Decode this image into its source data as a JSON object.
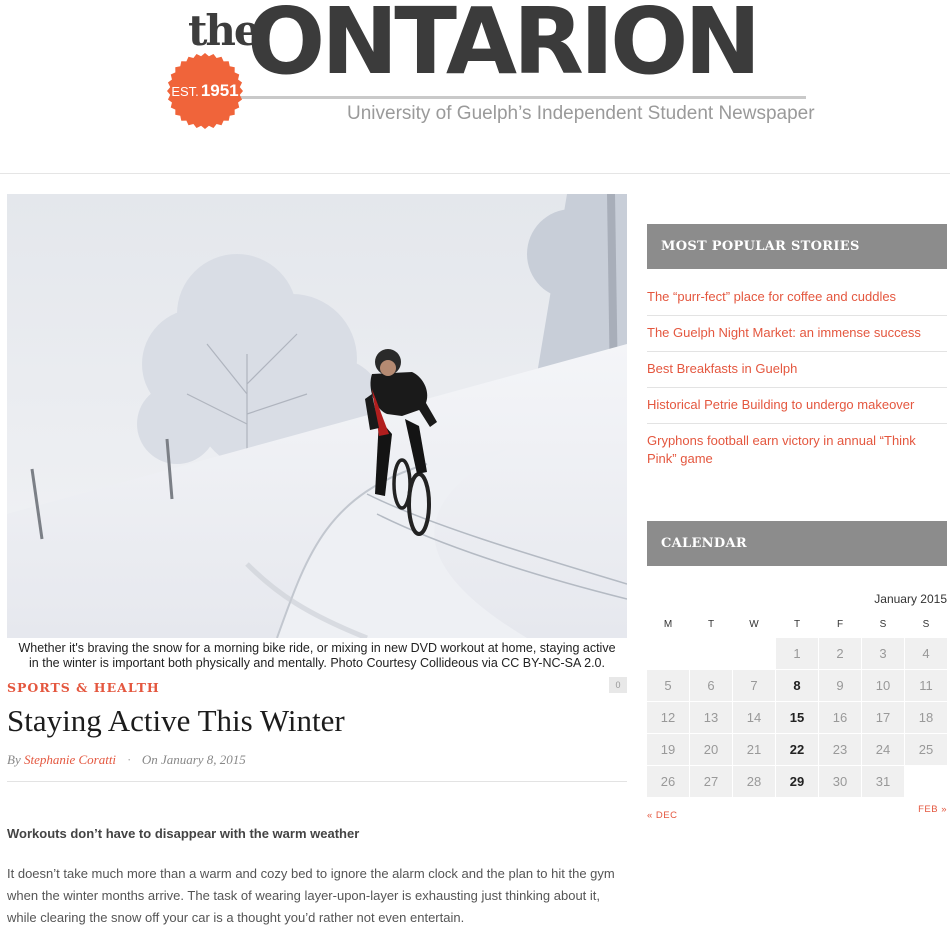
{
  "masthead": {
    "logo_the": "the",
    "logo_main": "ONTARION",
    "badge_est": "EST.",
    "badge_year": "1951",
    "tagline": "University of Guelph’s Independent Student Newspaper",
    "badge_color": "#f0643a"
  },
  "article": {
    "image_alt": "Cyclist riding up a snowy road",
    "caption": "Whether it's braving the snow for a morning bike ride, or mixing in new DVD workout at home, staying active in the winter is important both physically and mentally. Photo Courtesy Collideous via CC BY-NC-SA 2.0.",
    "category": "SPORTS & HEALTH",
    "comment_count": "0",
    "headline": "Staying Active This Winter",
    "by_label": "By",
    "author": "Stephanie Coratti",
    "separator": "·",
    "date": "On January 8, 2015",
    "subhead": "Workouts don’t have to disappear with the warm weather",
    "body": "It doesn’t take much more than a warm and cozy bed to ignore the alarm clock and the plan to hit the gym when the winter months arrive. The task of wearing layer-upon-layer is exhausting just thinking about it, while clearing the snow off your car is a thought you’d rather not even entertain."
  },
  "sidebar": {
    "popular_title": "MOST POPULAR STORIES",
    "popular": [
      "The “purr-fect” place for coffee and cuddles",
      "The Guelph Night Market: an immense success",
      "Best Breakfasts in Guelph",
      "Historical Petrie Building to undergo makeover",
      "Gryphons football earn victory in annual “Think Pink” game"
    ],
    "calendar_title": "CALENDAR",
    "calendar": {
      "caption": "January 2015",
      "weekdays": [
        "M",
        "T",
        "W",
        "T",
        "F",
        "S",
        "S"
      ],
      "weeks": [
        [
          "",
          "",
          "",
          "1",
          "2",
          "3",
          "4"
        ],
        [
          "5",
          "6",
          "7",
          "8",
          "9",
          "10",
          "11"
        ],
        [
          "12",
          "13",
          "14",
          "15",
          "16",
          "17",
          "18"
        ],
        [
          "19",
          "20",
          "21",
          "22",
          "23",
          "24",
          "25"
        ],
        [
          "26",
          "27",
          "28",
          "29",
          "30",
          "31",
          ""
        ]
      ],
      "post_days": [
        "8",
        "15",
        "22",
        "29"
      ],
      "prev": "« DEC",
      "next": "FEB »"
    }
  },
  "colors": {
    "accent": "#e4573f",
    "widget_header": "#8c8c8c"
  }
}
